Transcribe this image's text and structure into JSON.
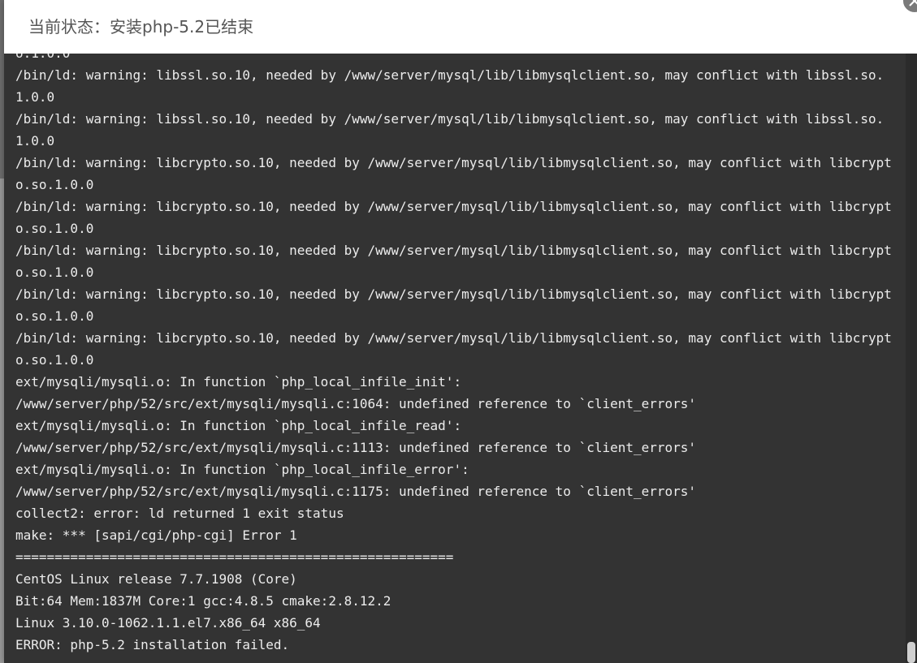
{
  "dialog": {
    "title": "当前状态：安装php-5.2已结束",
    "close_icon": "close-icon"
  },
  "console": {
    "cut_line": "o.1.0.0",
    "lines": [
      "/bin/ld: warning: libssl.so.10, needed by /www/server/mysql/lib/libmysqlclient.so, may conflict with libssl.so.1.0.0",
      "/bin/ld: warning: libssl.so.10, needed by /www/server/mysql/lib/libmysqlclient.so, may conflict with libssl.so.1.0.0",
      "/bin/ld: warning: libcrypto.so.10, needed by /www/server/mysql/lib/libmysqlclient.so, may conflict with libcrypto.so.1.0.0",
      "/bin/ld: warning: libcrypto.so.10, needed by /www/server/mysql/lib/libmysqlclient.so, may conflict with libcrypto.so.1.0.0",
      "/bin/ld: warning: libcrypto.so.10, needed by /www/server/mysql/lib/libmysqlclient.so, may conflict with libcrypto.so.1.0.0",
      "/bin/ld: warning: libcrypto.so.10, needed by /www/server/mysql/lib/libmysqlclient.so, may conflict with libcrypto.so.1.0.0",
      "/bin/ld: warning: libcrypto.so.10, needed by /www/server/mysql/lib/libmysqlclient.so, may conflict with libcrypto.so.1.0.0",
      "ext/mysqli/mysqli.o: In function `php_local_infile_init':",
      "/www/server/php/52/src/ext/mysqli/mysqli.c:1064: undefined reference to `client_errors'",
      "ext/mysqli/mysqli.o: In function `php_local_infile_read':",
      "/www/server/php/52/src/ext/mysqli/mysqli.c:1113: undefined reference to `client_errors'",
      "ext/mysqli/mysqli.o: In function `php_local_infile_error':",
      "/www/server/php/52/src/ext/mysqli/mysqli.c:1175: undefined reference to `client_errors'",
      "collect2: error: ld returned 1 exit status",
      "make: *** [sapi/cgi/php-cgi] Error 1",
      "========================================================",
      "CentOS Linux release 7.7.1908 (Core)",
      "Bit:64 Mem:1837M Core:1 gcc:4.8.5 cmake:2.8.12.2",
      "Linux 3.10.0-1062.1.1.el7.x86_64 x86_64",
      "ERROR: php-5.2 installation failed."
    ]
  },
  "colors": {
    "console_bg": "#333333",
    "console_text": "#ececec",
    "title_text": "#555555"
  }
}
